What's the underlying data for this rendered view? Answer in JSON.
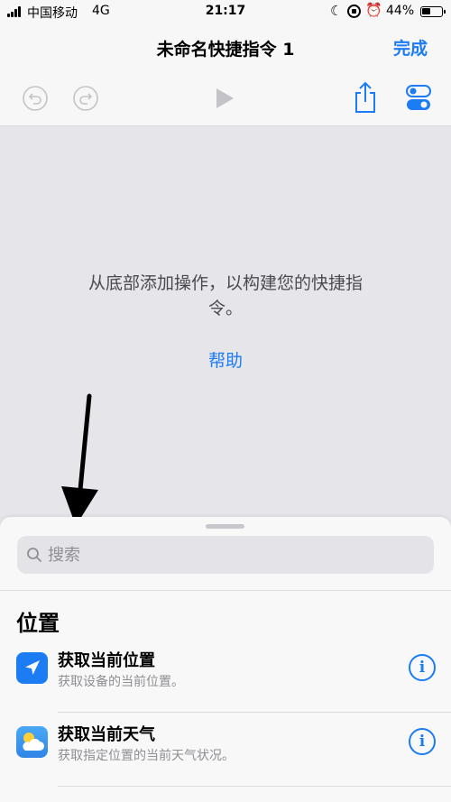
{
  "status_bar": {
    "carrier": "中国移动",
    "network": "4G",
    "time": "21:17",
    "battery_percent": "44%",
    "battery_level": 0.44
  },
  "nav": {
    "title": "未命名快捷指令 1",
    "done_label": "完成"
  },
  "toolbar": {
    "icons": [
      "undo-icon",
      "redo-icon",
      "play-icon",
      "share-icon",
      "settings-toggle-icon"
    ]
  },
  "canvas": {
    "empty_message": "从底部添加操作，以构建您的快捷指令。",
    "help_label": "帮助"
  },
  "sheet": {
    "search_placeholder": "搜索",
    "section_title": "位置",
    "actions": [
      {
        "title": "获取当前位置",
        "subtitle": "获取设备的当前位置。",
        "icon": "location-arrow-icon",
        "icon_color": "#1c7cf4"
      },
      {
        "title": "获取当前天气",
        "subtitle": "获取指定位置的当前天气状况。",
        "icon": "weather-icon",
        "icon_color": "#3a92ec"
      }
    ]
  },
  "colors": {
    "accent": "#1c7cf4",
    "canvas_bg": "#e5e5ea",
    "bar_bg": "#f7f7f7"
  }
}
